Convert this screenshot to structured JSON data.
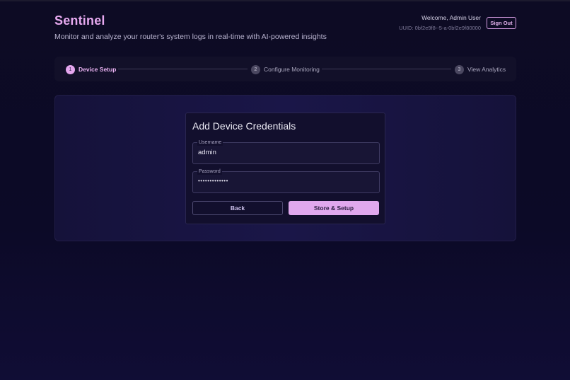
{
  "header": {
    "title": "Sentinel",
    "subtitle": "Monitor and analyze your router's system logs in real-time with AI-powered insights",
    "welcome": "Welcome, Admin User",
    "uuid": "UUID: 0bf2e9f8--5-a-0bf2e9f80000",
    "sign_out_label": "Sign Out"
  },
  "stepper": {
    "steps": [
      {
        "number": "1",
        "label": "Device Setup",
        "state": "active"
      },
      {
        "number": "2",
        "label": "Configure Monitoring",
        "state": "inactive"
      },
      {
        "number": "3",
        "label": "View Analytics",
        "state": "inactive"
      }
    ]
  },
  "form": {
    "title": "Add Device Credentials",
    "username": {
      "label": "Username",
      "value": "admin"
    },
    "password": {
      "label": "Password",
      "value": "•••••••••••••"
    },
    "back_label": "Back",
    "submit_label": "Store & Setup"
  },
  "colors": {
    "accent": "#e0a8ee",
    "background": "#0c0a27",
    "panel": "#1a1648"
  }
}
